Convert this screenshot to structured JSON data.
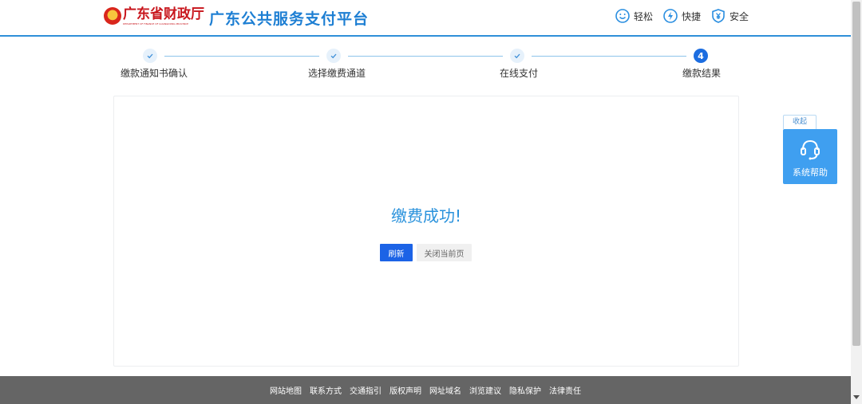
{
  "header": {
    "logo_cn": "广东省财政厅",
    "logo_en": "DEPARTMENT OF FINANCE OF GUANGDONG PROVINCE",
    "title": "广东公共服务支付平台",
    "features": [
      {
        "icon": "smile-icon",
        "label": "轻松"
      },
      {
        "icon": "lightning-icon",
        "label": "快捷"
      },
      {
        "icon": "shield-yen-icon",
        "label": "安全"
      }
    ]
  },
  "steps": [
    {
      "label": "缴款通知书确认",
      "state": "done"
    },
    {
      "label": "选择缴费通道",
      "state": "done"
    },
    {
      "label": "在线支付",
      "state": "done"
    },
    {
      "label": "缴款结果",
      "state": "active",
      "number": "4"
    }
  ],
  "result": {
    "message": "缴费成功!",
    "refresh_label": "刷新",
    "close_label": "关闭当前页"
  },
  "help": {
    "collapse_label": "收起",
    "label": "系统帮助",
    "icon": "headset-icon"
  },
  "footer": {
    "links": [
      "网站地图",
      "联系方式",
      "交通指引",
      "版权声明",
      "网址域名",
      "浏览建议",
      "隐私保护",
      "法律责任"
    ]
  },
  "colors": {
    "brand_blue": "#1e7fd3",
    "primary_button": "#1c63e6",
    "success_text": "#2a92dc",
    "logo_red": "#c8161d",
    "footer_bg": "#656565"
  }
}
